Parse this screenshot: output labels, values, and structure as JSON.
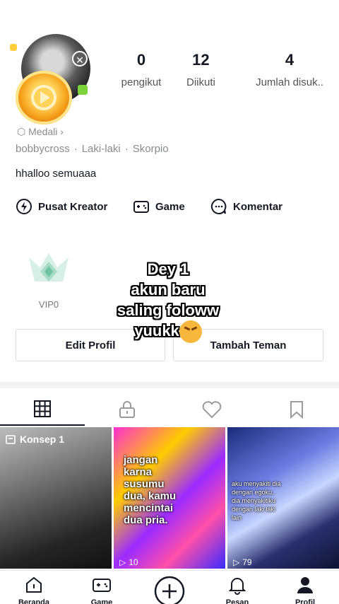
{
  "profile": {
    "stats": [
      {
        "value": "0",
        "label": "pengikut"
      },
      {
        "value": "12",
        "label": "Diikuti"
      },
      {
        "value": "4",
        "label": "Jumlah disuk.."
      }
    ],
    "medali": "Medali",
    "username": "bobbycross",
    "gender": "Laki-laki",
    "zodiac": "Skorpio",
    "bio": "hhalloo semuaaa"
  },
  "shortcuts": [
    {
      "label": "Pusat Kreator",
      "icon": "lightning-icon"
    },
    {
      "label": "Game",
      "icon": "gamepad-icon"
    },
    {
      "label": "Komentar",
      "icon": "comment-icon"
    }
  ],
  "vip": {
    "label": "VIP0"
  },
  "overlay_text": {
    "line1": "Dey 1",
    "line2": "akun baru",
    "line3": "saling foloww",
    "line4": "yuukk"
  },
  "buttons": {
    "edit": "Edit Profil",
    "add_friend": "Tambah Teman"
  },
  "tabs": [
    "grid-icon",
    "lock-icon",
    "heart-icon",
    "bookmark-icon"
  ],
  "videos": [
    {
      "pinned_label": "Konsep 1",
      "caption": "",
      "views": ""
    },
    {
      "pinned_label": "",
      "caption": "jangan karna susumu dua, kamu mencintai dua pria.",
      "views": "10"
    },
    {
      "pinned_label": "",
      "caption": "aku menyakiti dia dengan egoku, dia menyakitiku dengan laki laki lain",
      "views": "79"
    }
  ],
  "bottom_nav": [
    {
      "label": "Beranda",
      "icon": "home-icon"
    },
    {
      "label": "Game",
      "icon": "gamepad-icon"
    },
    {
      "label": "",
      "icon": "plus-icon"
    },
    {
      "label": "Pesan",
      "icon": "bell-icon"
    },
    {
      "label": "Profil",
      "icon": "profile-icon"
    }
  ],
  "colors": {
    "text": "#161823",
    "muted": "#8a8b91",
    "accent": "#fe2c55"
  }
}
